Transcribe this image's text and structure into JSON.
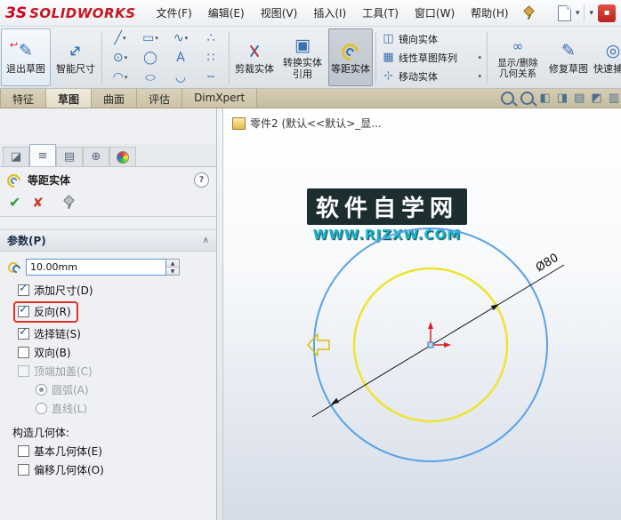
{
  "menubar": {
    "logo_mark": "3S",
    "logo_text": "SOLIDWORKS",
    "menus": [
      "文件(F)",
      "编辑(E)",
      "视图(V)",
      "插入(I)",
      "工具(T)",
      "窗口(W)",
      "帮助(H)"
    ]
  },
  "toolbar": {
    "exit_sketch": "退出草图",
    "smart_dimension": "智能尺寸",
    "trim": "剪裁实体",
    "convert": "转换实体引用",
    "offset": "等距实体",
    "mirror": "镜向实体",
    "linear_pattern": "线性草图阵列",
    "move": "移动实体",
    "display_delete_relations": "显示/删除几何关系",
    "repair_sketch": "修复草图",
    "quick_snaps": "快速捕捉",
    "clipped_button": "快",
    "icons": [
      "line-icon",
      "rectangle-icon",
      "spline-icon",
      "point-pattern-icon",
      "circle-icon",
      "polygon-icon",
      "text-icon",
      "dots-icon",
      "arc-icon",
      "ellipse-icon",
      "fillet-icon",
      "centerline-icon"
    ]
  },
  "command_tabs": {
    "items": [
      "特征",
      "草图",
      "曲面",
      "评估",
      "DimXpert"
    ],
    "active": "草图"
  },
  "property_manager": {
    "title": "等距实体",
    "params": {
      "header": "参数(P)",
      "distance": "10.00mm",
      "options": [
        {
          "label": "添加尺寸(D)",
          "checked": true
        },
        {
          "label": "反向(R)",
          "checked": true,
          "highlighted": true
        },
        {
          "label": "选择链(S)",
          "checked": true
        },
        {
          "label": "双向(B)",
          "checked": false
        },
        {
          "label": "顶端加盖(C)",
          "checked": false,
          "disabled": true
        }
      ],
      "cap_radios": [
        {
          "label": "圆弧(A)",
          "selected": true,
          "disabled": true
        },
        {
          "label": "直线(L)",
          "selected": false,
          "disabled": true
        }
      ],
      "construction_label": "构造几何体:",
      "construction_options": [
        {
          "label": "基本几何体(E)",
          "checked": false
        },
        {
          "label": "偏移几何体(O)",
          "checked": false
        }
      ]
    }
  },
  "viewport": {
    "tree_item": "零件2 (默认<<默认>_显...",
    "watermark": {
      "line1": "软件自学网",
      "line2": "WWW.RJZXW.COM"
    },
    "dimension_label": "Ø80"
  },
  "colors": {
    "circle_blue": "#5aa2e6",
    "circle_yellow": "#ede432",
    "annotation_red": "#e03226",
    "origin_red": "#e02020",
    "watermark_teal": "#17b8cc",
    "accent_blue": "#5a96d2"
  }
}
